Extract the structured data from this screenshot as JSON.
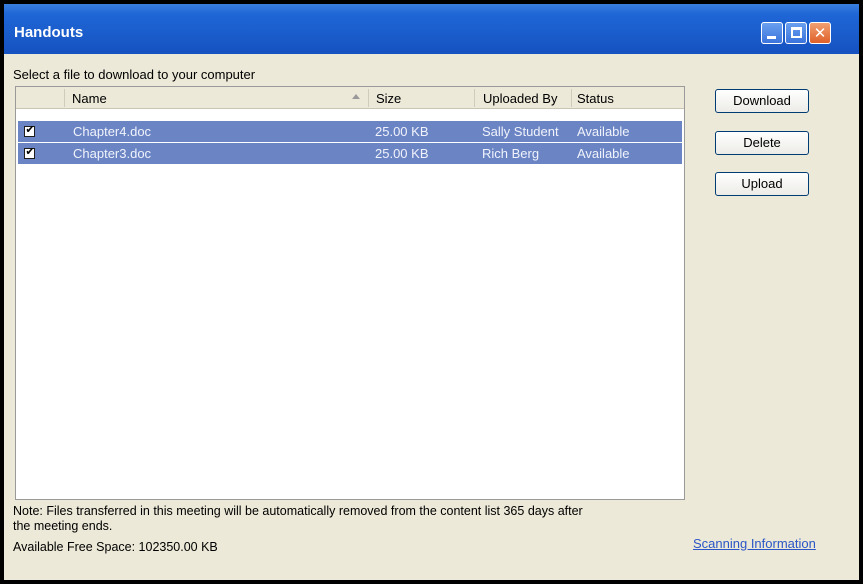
{
  "window": {
    "title": "Handouts",
    "close_glyph": "✕"
  },
  "instruction": "Select a file to download to your computer",
  "table": {
    "columns": [
      "Name",
      "Size",
      "Uploaded By",
      "Status"
    ],
    "sort_column": "Name",
    "rows": [
      {
        "checked": true,
        "check_glyph": "✔",
        "name": "Chapter4.doc",
        "size": "25.00 KB",
        "uploaded_by": "Sally Student",
        "status": "Available"
      },
      {
        "checked": true,
        "check_glyph": "✔",
        "name": "Chapter3.doc",
        "size": "25.00 KB",
        "uploaded_by": "Rich Berg",
        "status": "Available"
      }
    ]
  },
  "buttons": {
    "download": "Download",
    "delete": "Delete",
    "upload": "Upload"
  },
  "footer": {
    "note": "Note: Files transferred in this meeting will be automatically removed from the content list 365 days after the meeting ends.",
    "free_space": "Available Free Space: 102350.00 KB",
    "scan_link": "Scanning Information"
  },
  "colors": {
    "titlebar": "#1f66d6",
    "selected_row": "#6b84c4",
    "link": "#2a56c6"
  },
  "icons": {
    "minimize": "minimize-icon",
    "maximize": "maximize-icon",
    "close": "close-icon",
    "sort": "sort-ascending-icon",
    "checkbox": "checkbox-checked-icon"
  }
}
